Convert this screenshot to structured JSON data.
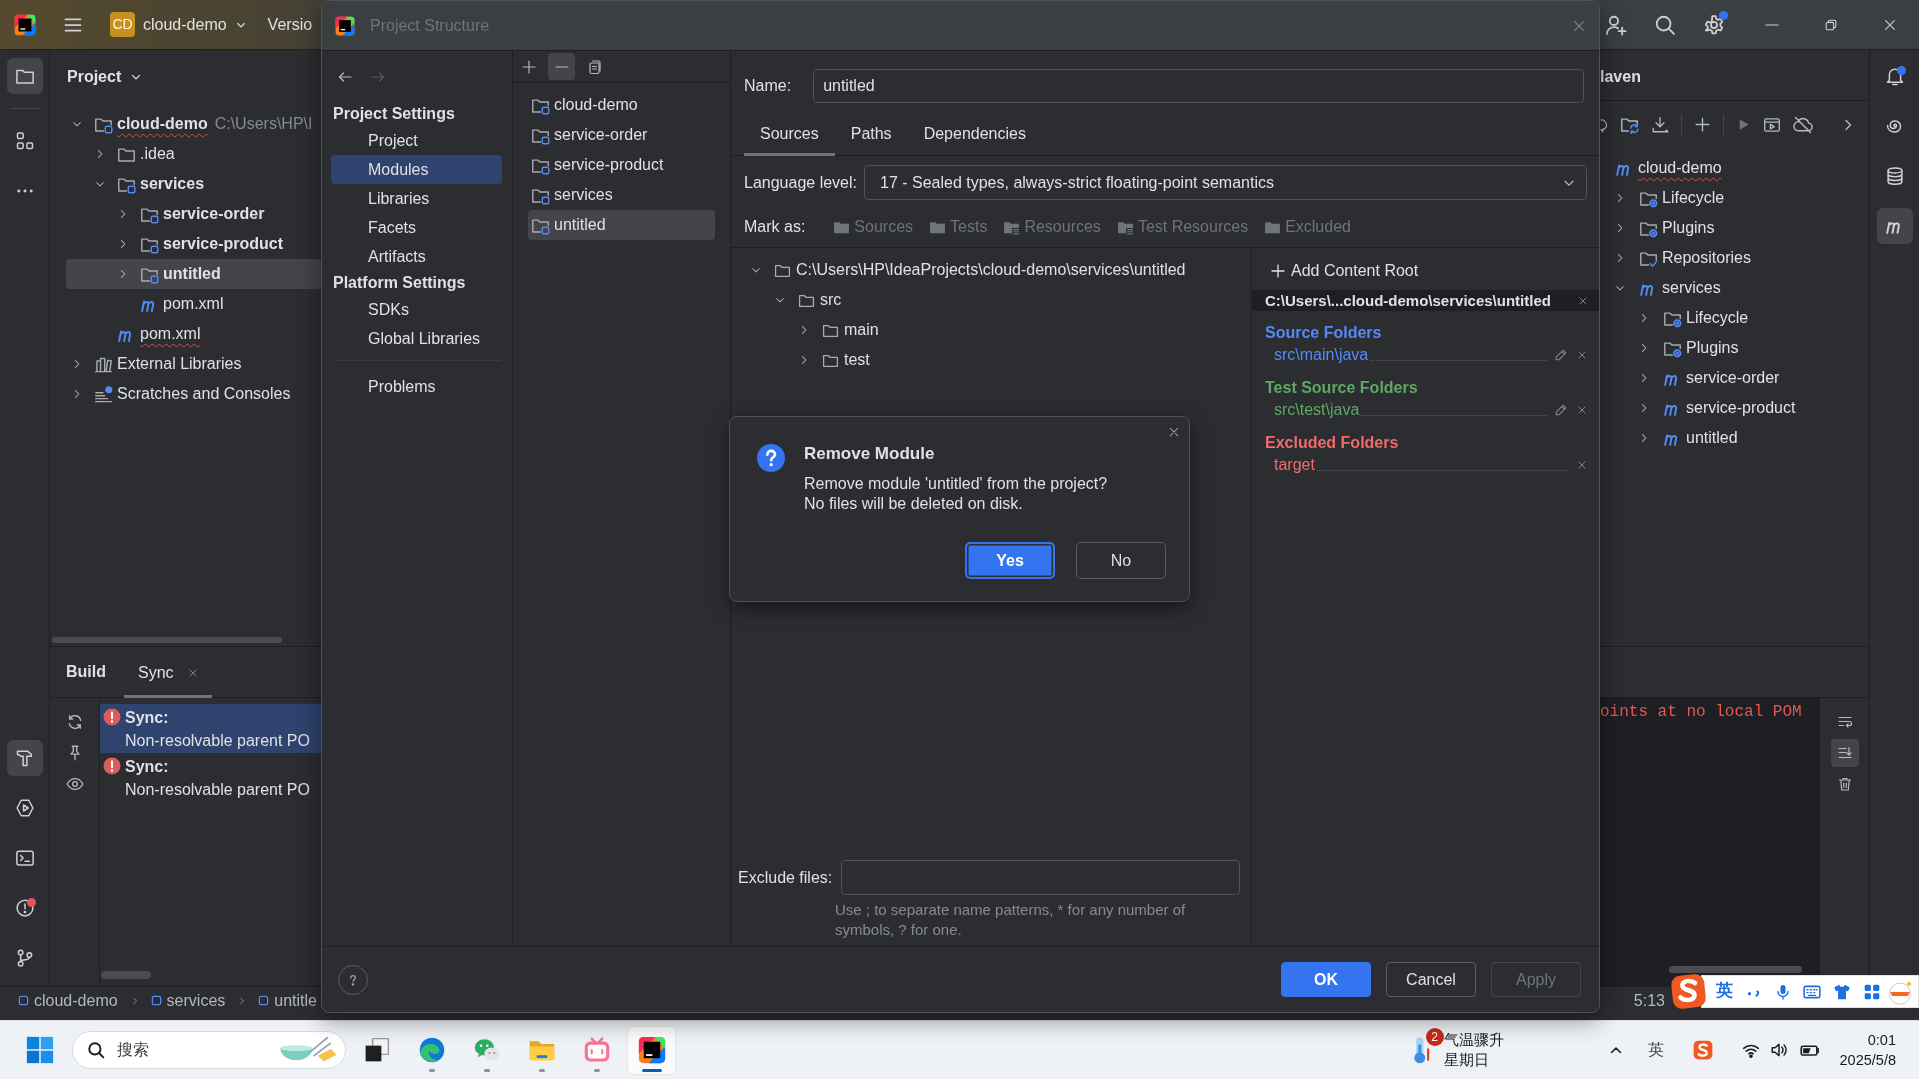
{
  "title_bar": {
    "project_badge": "CD",
    "project_name": "cloud-demo",
    "menu_item": "Versio",
    "actions": [
      {
        "kind": "add-user",
        "dot": false
      },
      {
        "kind": "search",
        "dot": false
      },
      {
        "kind": "settings",
        "dot": true
      }
    ]
  },
  "left_toolbar": {
    "top": [
      {
        "kind": "project",
        "selected": true,
        "dot": false
      },
      {
        "kind": "structure",
        "selected": false,
        "dot": false
      },
      {
        "kind": "more",
        "selected": false,
        "dot": false
      }
    ],
    "bottom": [
      {
        "kind": "build",
        "selected": true,
        "dot": false
      },
      {
        "kind": "run",
        "selected": false,
        "dot": false
      },
      {
        "kind": "terminal",
        "selected": false,
        "dot": false
      },
      {
        "kind": "problems",
        "selected": false,
        "dot": true
      },
      {
        "kind": "git",
        "selected": false,
        "dot": false
      }
    ]
  },
  "project_panel": {
    "title": "Project",
    "tree": [
      {
        "kind": "module",
        "label": "cloud-demo",
        "path": "C:\\Users\\HP\\I",
        "expanded": true,
        "selected": false,
        "misspelled": true,
        "children": [
          {
            "kind": "folder",
            "label": ".idea",
            "expanded": false,
            "selected": false,
            "misspelled": false
          },
          {
            "kind": "module",
            "label": "services",
            "expanded": true,
            "selected": false,
            "misspelled": false,
            "children": [
              {
                "kind": "module",
                "label": "service-order",
                "expanded": false,
                "selected": false,
                "misspelled": false
              },
              {
                "kind": "module",
                "label": "service-product",
                "expanded": false,
                "selected": false,
                "misspelled": false
              },
              {
                "kind": "module",
                "label": "untitled",
                "expanded": false,
                "selected": true,
                "misspelled": false
              },
              {
                "kind": "pom",
                "label": "pom.xml",
                "selected": false,
                "misspelled": false
              }
            ]
          },
          {
            "kind": "pom",
            "label": "pom.xml",
            "selected": false,
            "misspelled": true
          }
        ]
      },
      {
        "kind": "library",
        "label": "External Libraries",
        "expanded": false,
        "selected": false,
        "misspelled": false
      },
      {
        "kind": "scratches",
        "label": "Scratches and Consoles",
        "expanded": false,
        "selected": false,
        "misspelled": false
      }
    ]
  },
  "build_panel": {
    "title": "Build",
    "tabs": [
      {
        "label": "Sync",
        "selected": true
      }
    ],
    "messages": [
      {
        "title": "Sync:",
        "detail": "Non-resolvable parent PO",
        "selected": true
      },
      {
        "title": "Sync:",
        "detail": "Non-resolvable parent PO",
        "selected": false
      }
    ]
  },
  "status_bar": {
    "breadcrumbs": [
      "cloud-demo",
      "services",
      "untitle"
    ],
    "caret_position": "5:13"
  },
  "maven_panel": {
    "title": "laven",
    "tree": [
      {
        "kind": "maven",
        "label": "cloud-demo",
        "misspelled": true,
        "children": [
          {
            "kind": "lifecycle",
            "label": "Lifecycle",
            "expanded": false,
            "misspelled": false
          },
          {
            "kind": "plugins",
            "label": "Plugins",
            "expanded": false,
            "misspelled": false
          },
          {
            "kind": "repositories",
            "label": "Repositories",
            "expanded": false,
            "misspelled": false
          },
          {
            "kind": "maven",
            "label": "services",
            "expanded": true,
            "misspelled": false,
            "children": [
              {
                "kind": "lifecycle",
                "label": "Lifecycle",
                "expanded": false,
                "misspelled": false
              },
              {
                "kind": "plugins",
                "label": "Plugins",
                "expanded": false,
                "misspelled": false
              },
              {
                "kind": "maven",
                "label": "service-order",
                "expanded": false,
                "misspelled": false
              },
              {
                "kind": "maven",
                "label": "service-product",
                "expanded": false,
                "misspelled": false
              },
              {
                "kind": "maven",
                "label": "untitled",
                "expanded": false,
                "misspelled": false
              }
            ]
          }
        ]
      }
    ]
  },
  "console": {
    "lines": [
      "oints at no local POM"
    ],
    "toolbar": [
      {
        "kind": "soft-wrap",
        "selected": false
      },
      {
        "kind": "scroll-to-end",
        "selected": true
      },
      {
        "kind": "clear",
        "selected": false
      }
    ]
  },
  "right_toolbar": [
    {
      "kind": "notifications",
      "selected": false,
      "dot": true
    },
    {
      "kind": "ai-assistant",
      "selected": false,
      "dot": false
    },
    {
      "kind": "database",
      "selected": false,
      "dot": false
    },
    {
      "kind": "maven",
      "selected": true,
      "dot": false
    }
  ],
  "dialog": {
    "title": "Project Structure",
    "nav_arrows": [
      {
        "kind": "back",
        "disabled": false
      },
      {
        "kind": "forward",
        "disabled": true
      }
    ],
    "nav": [
      {
        "heading": "Project Settings",
        "items": [
          {
            "label": "Project",
            "selected": false
          },
          {
            "label": "Modules",
            "selected": true
          },
          {
            "label": "Libraries",
            "selected": false
          },
          {
            "label": "Facets",
            "selected": false
          },
          {
            "label": "Artifacts",
            "selected": false
          }
        ]
      },
      {
        "heading": "Platform Settings",
        "items": [
          {
            "label": "SDKs",
            "selected": false
          },
          {
            "label": "Global Libraries",
            "selected": false
          }
        ]
      }
    ],
    "nav_footer": [
      {
        "label": "Problems",
        "selected": false
      }
    ],
    "module_toolbar": [
      {
        "kind": "add",
        "pressed": false
      },
      {
        "kind": "remove",
        "pressed": true
      },
      {
        "kind": "copy",
        "pressed": false
      }
    ],
    "modules": [
      {
        "label": "cloud-demo",
        "selected": false
      },
      {
        "label": "service-order",
        "selected": false
      },
      {
        "label": "service-product",
        "selected": false
      },
      {
        "label": "services",
        "selected": false
      },
      {
        "label": "untitled",
        "selected": true
      }
    ],
    "name_field": {
      "label": "Name:",
      "value": "untitled"
    },
    "tabs": [
      {
        "label": "Sources",
        "selected": true
      },
      {
        "label": "Paths",
        "selected": false
      },
      {
        "label": "Dependencies",
        "selected": false
      }
    ],
    "language_level": {
      "label": "Language level:",
      "value": "17 - Sealed types, always-strict floating-point semantics"
    },
    "mark_as": {
      "label": "Mark as:",
      "options": [
        {
          "kind": "sources",
          "label": "Sources",
          "disabled": true
        },
        {
          "kind": "tests",
          "label": "Tests",
          "disabled": true
        },
        {
          "kind": "resources",
          "label": "Resources",
          "disabled": true
        },
        {
          "kind": "test-resources",
          "label": "Test Resources",
          "disabled": true
        },
        {
          "kind": "excluded",
          "label": "Excluded",
          "disabled": true
        }
      ]
    },
    "content_tree": [
      {
        "label": "C:\\Users\\HP\\IdeaProjects\\cloud-demo\\services\\untitled",
        "expanded": true,
        "children": [
          {
            "label": "src",
            "expanded": true,
            "children": [
              {
                "label": "main",
                "expanded": false
              },
              {
                "label": "test",
                "expanded": false
              }
            ]
          }
        ]
      }
    ],
    "content_root": {
      "add_label": "Add Content Root",
      "path": "C:\\Users\\...cloud-demo\\services\\untitled",
      "groups": [
        {
          "kind": "source",
          "heading": "Source Folders",
          "entries": [
            {
              "path": "src\\main\\java",
              "editable": true
            }
          ]
        },
        {
          "kind": "test",
          "heading": "Test Source Folders",
          "entries": [
            {
              "path": "src\\test\\java",
              "editable": true
            }
          ]
        },
        {
          "kind": "excluded",
          "heading": "Excluded Folders",
          "entries": [
            {
              "path": "target",
              "editable": false
            }
          ]
        }
      ]
    },
    "exclude_files": {
      "label": "Exclude files:",
      "hint": "Use ; to separate name patterns, * for any number of symbols, ? for one."
    },
    "buttons": [
      {
        "kind": "primary",
        "label": "OK",
        "disabled": false
      },
      {
        "kind": "secondary",
        "label": "Cancel",
        "disabled": false
      },
      {
        "kind": "secondary",
        "label": "Apply",
        "disabled": true
      }
    ]
  },
  "confirm_dialog": {
    "title": "Remove Module",
    "message": [
      "Remove module 'untitled' from the project?",
      "No files will be deleted on disk."
    ],
    "buttons": [
      {
        "kind": "primary",
        "label": "Yes",
        "focused": true
      },
      {
        "kind": "secondary",
        "label": "No",
        "focused": false
      }
    ]
  },
  "taskbar": {
    "search": {
      "placeholder": "搜索"
    },
    "apps": [
      {
        "kind": "task-view",
        "running": false,
        "active": false
      },
      {
        "kind": "browser",
        "running": true,
        "active": false
      },
      {
        "kind": "chat",
        "running": true,
        "active": false
      },
      {
        "kind": "file-explorer",
        "running": true,
        "active": false
      },
      {
        "kind": "video",
        "running": true,
        "active": false
      },
      {
        "kind": "ide",
        "running": true,
        "active": true
      }
    ],
    "weather": {
      "badge": "2",
      "headline": "气温骤升",
      "day": "星期日"
    },
    "tray": {
      "input_language": "英"
    },
    "clock": {
      "time": "0:01",
      "date": "2025/5/8"
    }
  },
  "ime_toolbar": {
    "mode": "英"
  }
}
